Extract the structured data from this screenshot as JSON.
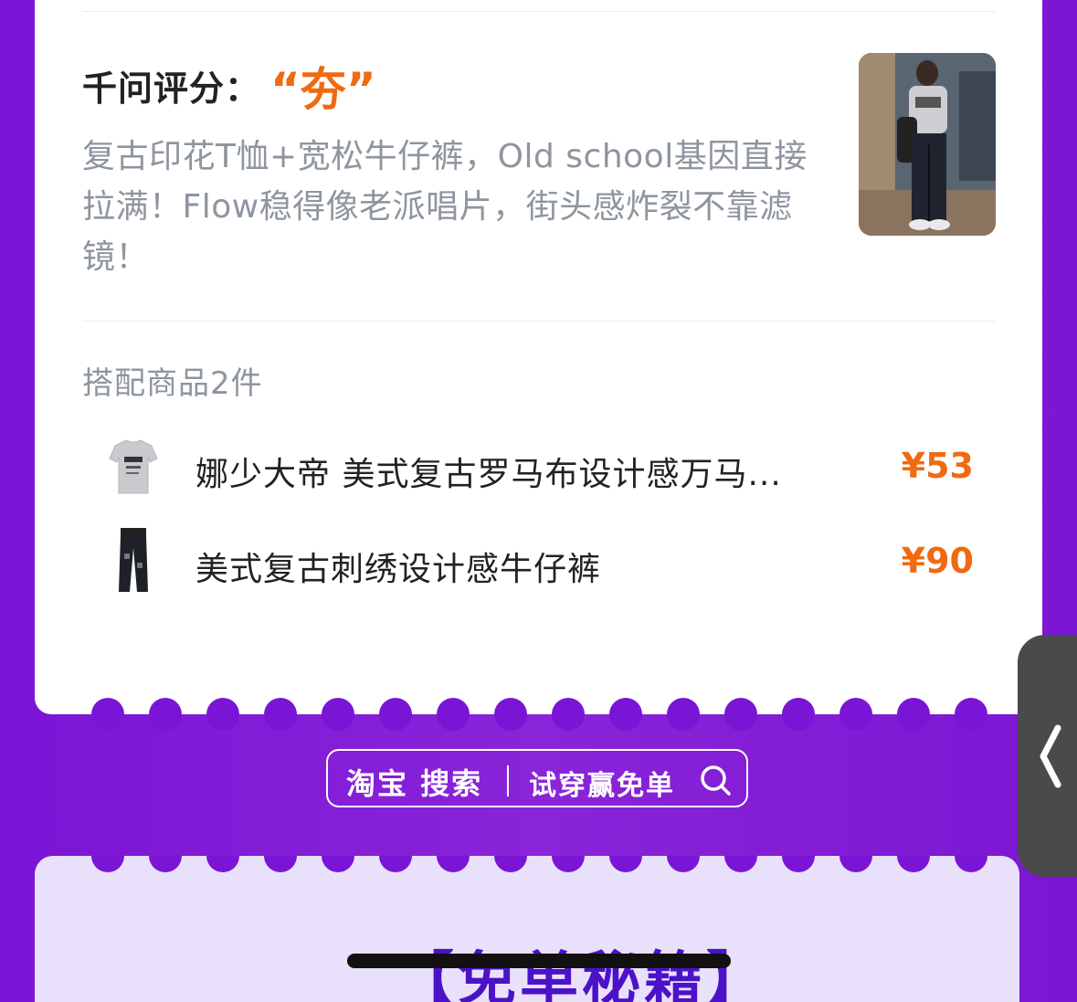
{
  "rating": {
    "label": "千问评分：",
    "value": "“夯”"
  },
  "description": "复古印花T恤+宽松牛仔裤，Old school基因直接拉满！Flow稳得像老派唱片，街头感炸裂不靠滤镜！",
  "outfit_photo": {
    "icon": "outfit-photo",
    "alt": "穿搭照片"
  },
  "match": {
    "title": "搭配商品2件",
    "items": [
      {
        "name": "娜少大帝 美式复古罗马布设计感万马...",
        "price": "¥53",
        "icon": "tshirt-thumbnail"
      },
      {
        "name": "美式复古刺绣设计感牛仔裤",
        "price": "¥90",
        "icon": "jeans-thumbnail"
      }
    ]
  },
  "search": {
    "brand": "淘宝 搜索",
    "cta": "试穿赢免单",
    "icon": "search-icon"
  },
  "lower_section": {
    "title": "【免单秘籍】"
  },
  "colors": {
    "background": "#7a15d6",
    "accent_orange": "#f06a10",
    "lower_card": "#e9e0fb",
    "lower_title": "#4b12c8"
  }
}
